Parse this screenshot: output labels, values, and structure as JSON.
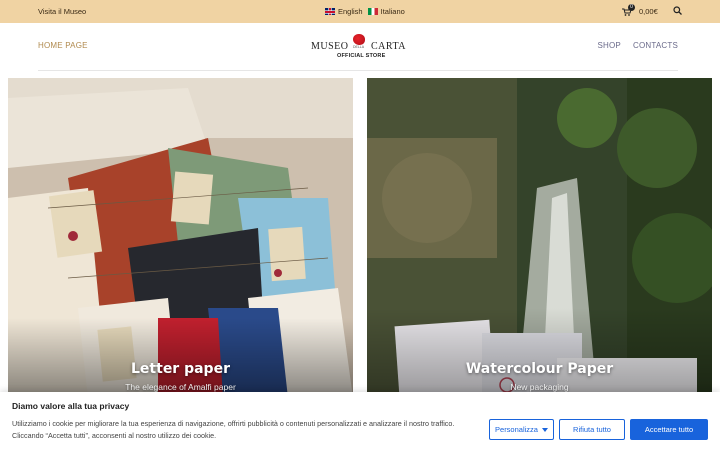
{
  "topbar": {
    "visit_label": "Visita il Museo",
    "languages": [
      {
        "label": "English",
        "flag": "uk-flag-icon"
      },
      {
        "label": "Italiano",
        "flag": "italy-flag-icon"
      }
    ],
    "cart_count": "0",
    "cart_total": "0,00€",
    "background": "#f0d3a3"
  },
  "header": {
    "home_label": "HOME PAGE",
    "logo": {
      "word1": "MUSEO",
      "della": "DELLA",
      "word2": "CARTA",
      "subtitle": "OFFICIAL STORE"
    },
    "nav": [
      {
        "label": "SHOP"
      },
      {
        "label": "CONTACTS"
      }
    ]
  },
  "cards": [
    {
      "title": "Letter paper",
      "subtitle": "The elegance of Amalfi paper"
    },
    {
      "title": "Watercolour Paper",
      "subtitle": "New packaging"
    }
  ],
  "cookie": {
    "title": "Diamo valore alla tua privacy",
    "text": "Utilizziamo i cookie per migliorare la tua esperienza di navigazione, offrirti pubblicità o contenuti personalizzati e analizzare il nostro traffico. Cliccando “Accetta tutti”, acconsenti al nostro utilizzo dei cookie.",
    "customize_label": "Personalizza",
    "reject_label": "Rifiuta tutto",
    "accept_label": "Accettare tutto",
    "accent": "#1863dc"
  }
}
